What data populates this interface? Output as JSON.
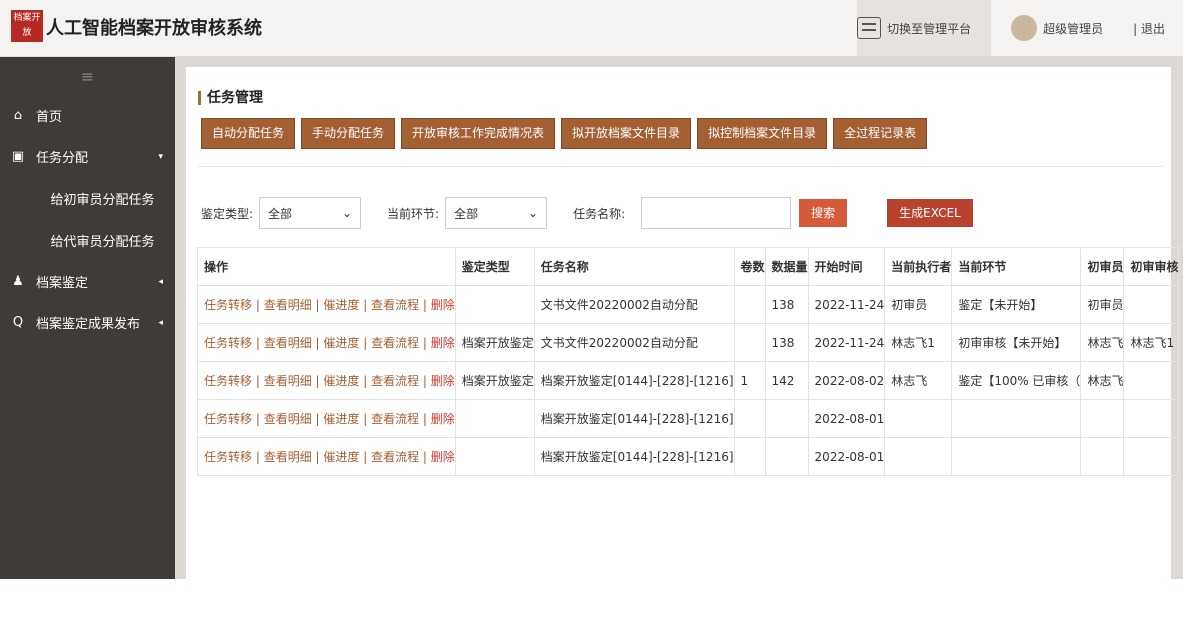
{
  "app": {
    "logo_text": "档案开放",
    "title": "人工智能档案开放审核系统"
  },
  "header": {
    "switch_label": "切换至管理平台",
    "user_label": "超级管理员",
    "logout_label": "| 退出"
  },
  "sidebar": {
    "menu_glyph": "≡",
    "items": [
      {
        "label": "首页",
        "icon": "home-icon",
        "glyph": "⌂"
      },
      {
        "label": "任务分配",
        "icon": "clipboard-icon",
        "glyph": "▣",
        "arrow": "▾"
      },
      {
        "label": "给初审员分配任务"
      },
      {
        "label": "给代审员分配任务"
      },
      {
        "label": "档案鉴定",
        "icon": "user-icon",
        "glyph": "♟",
        "arrow": "◂"
      },
      {
        "label": "档案鉴定成果发布",
        "icon": "search-icon",
        "glyph": "Q",
        "arrow": "◂"
      }
    ]
  },
  "main": {
    "heading": "任务管理",
    "buttons": [
      {
        "label": "自动分配任务"
      },
      {
        "label": "手动分配任务"
      },
      {
        "label": "开放审核工作完成情况表"
      },
      {
        "label": "拟开放档案文件目录"
      },
      {
        "label": "拟控制档案文件目录"
      },
      {
        "label": "全过程记录表"
      }
    ],
    "filters": {
      "type_label": "鉴定类型:",
      "type_value": "全部",
      "stage_label": "当前环节:",
      "stage_value": "全部",
      "name_label": "任务名称:",
      "name_value": "",
      "search_label": "搜索",
      "excel_label": "生成EXCEL",
      "chevron": "⌄"
    },
    "table": {
      "headers": [
        "操作",
        "鉴定类型",
        "任务名称",
        "卷数",
        "数据量",
        "开始时间",
        "当前执行者",
        "当前环节",
        "初审员",
        "初审审核"
      ],
      "op_links": [
        "任务转移",
        "查看明细",
        "催进度",
        "查看流程"
      ],
      "op_sep": " | ",
      "op_delete": "删除",
      "rows": [
        {
          "type": "",
          "name": "文书文件20220002自动分配",
          "volumes": "",
          "count": "138",
          "start": "2022-11-24",
          "executor": "初审员",
          "stage": "鉴定【未开始】",
          "reviewer": "初审员",
          "check": ""
        },
        {
          "type": "档案开放鉴定",
          "name": "文书文件20220002自动分配",
          "volumes": "",
          "count": "138",
          "start": "2022-11-24",
          "executor": "林志飞1",
          "stage": "初审审核【未开始】",
          "reviewer": "林志飞",
          "check": "林志飞1"
        },
        {
          "type": "档案开放鉴定",
          "name": "档案开放鉴定[0144]-[228]-[1216]",
          "volumes": "1",
          "count": "142",
          "start": "2022-08-02",
          "executor": "林志飞",
          "stage": "鉴定【100% 已审核（",
          "reviewer": "林志飞",
          "check": ""
        },
        {
          "type": "",
          "name": "档案开放鉴定[0144]-[228]-[1216]",
          "volumes": "",
          "count": "",
          "start": "2022-08-01",
          "executor": "",
          "stage": "",
          "reviewer": "",
          "check": ""
        },
        {
          "type": "",
          "name": "档案开放鉴定[0144]-[228]-[1216]",
          "volumes": "",
          "count": "",
          "start": "2022-08-01",
          "executor": "",
          "stage": "",
          "reviewer": "",
          "check": ""
        }
      ]
    }
  },
  "colors": {
    "brand": "#a45f33",
    "sidebar_bg": "#3f3b37",
    "search_button": "#d45a3a",
    "excel_button": "#b8422d",
    "delete_link": "#d03a2f"
  }
}
